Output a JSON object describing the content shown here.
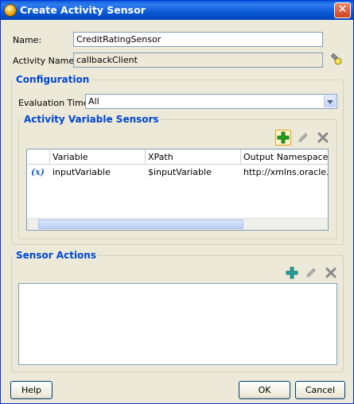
{
  "window": {
    "title": "Create Activity Sensor",
    "close_glyph": "✕"
  },
  "form": {
    "name_label": "Name:",
    "name_value": "CreditRatingSensor",
    "activity_label": "Activity Name:",
    "activity_value": "callbackClient"
  },
  "configuration": {
    "title": "Configuration",
    "eval_label": "Evaluation Time:",
    "eval_value": "All"
  },
  "variable_sensors": {
    "title": "Activity Variable Sensors",
    "columns": [
      "Variable",
      "XPath",
      "Output Namespace"
    ],
    "rows": [
      {
        "icon": "(x)",
        "variable": "inputVariable",
        "xpath": "$inputVariable",
        "namespace": "http://xmlns.oracle.c..."
      }
    ]
  },
  "sensor_actions": {
    "title": "Sensor Actions"
  },
  "buttons": {
    "help": "Help",
    "ok": "OK",
    "cancel": "Cancel"
  },
  "colors": {
    "group_title": "#0046d5",
    "add_icon": "#22a020",
    "titlebar": "#0b59d5"
  },
  "icons": [
    "app-icon",
    "close-icon",
    "flashlight-icon",
    "add-icon",
    "edit-icon",
    "delete-icon",
    "variable-icon"
  ]
}
